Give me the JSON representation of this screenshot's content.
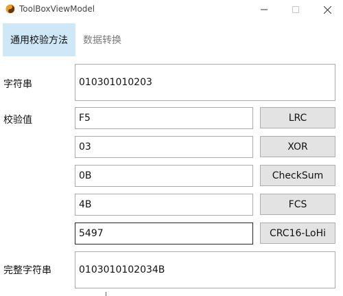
{
  "window": {
    "title": "ToolBoxViewModel"
  },
  "tabs": [
    {
      "label": "通用校验方法",
      "active": true
    },
    {
      "label": "数据转换",
      "active": false
    }
  ],
  "input": {
    "label": "字符串",
    "value": "010301010203"
  },
  "checks": {
    "label": "校验值",
    "rows": [
      {
        "value": "F5",
        "button": "LRC"
      },
      {
        "value": "03",
        "button": "XOR"
      },
      {
        "value": "0B",
        "button": "CheckSum"
      },
      {
        "value": "4B",
        "button": "FCS"
      },
      {
        "value": "5497",
        "button": "CRC16-LoHi"
      }
    ]
  },
  "result": {
    "label": "完整字符串",
    "value": "0103010102034B"
  },
  "colors": {
    "active_tab_bg": "#cfe8f8",
    "button_bg": "#e3e3e3",
    "border": "#a9a9a9"
  }
}
